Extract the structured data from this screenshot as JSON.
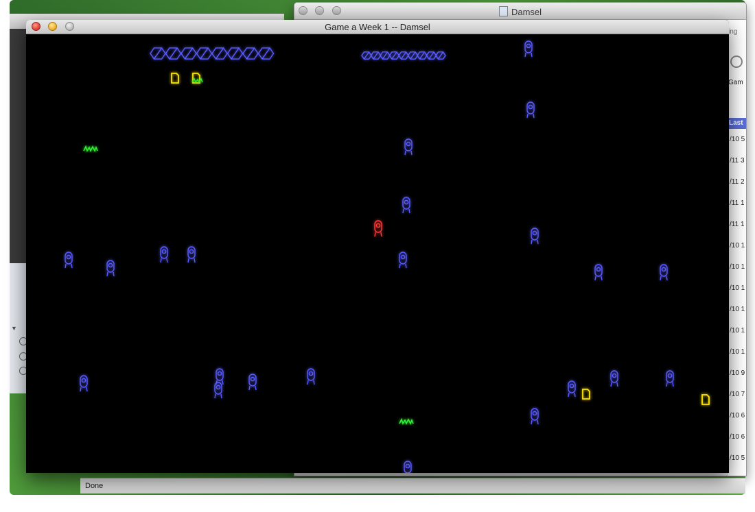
{
  "background_window": {
    "title": "Damsel",
    "partial_text_top_right": "ing",
    "partial_column_header": "Gam",
    "partial_selected_header": "Last P",
    "partial_dates": [
      "/10 5",
      "/11 3",
      "/11 2",
      "/11 1",
      "/11 1",
      "/10 1",
      "/10 1",
      "/10 1",
      "/10 1",
      "/10 1",
      "/10 1",
      "/10 9",
      "/10 7",
      "/10 6",
      "/10 6",
      "/10 5"
    ]
  },
  "status_bar": {
    "text": "Done"
  },
  "game_window": {
    "title": "Game a Week 1 -- Damsel",
    "colors": {
      "background": "#000000",
      "curb": "#ffffff",
      "lane_marking": "#d8c400",
      "pedestrian": "#5a5cff",
      "player": "#ff3a3a",
      "item": "#ffe600",
      "monster": "#33ee33",
      "health_good": "#33cc33",
      "health_bad": "#ee3333",
      "marker": "#4a4cff"
    },
    "hud": {
      "hex_row_large_count": 8,
      "hex_row_small_count": 9,
      "collected_items_count": 2,
      "health_bar_fill_fraction": 0.2
    },
    "entities": {
      "pedestrians_count": 27,
      "player_count": 1,
      "items_on_ground_count": 2,
      "monsters_count": 2
    }
  }
}
